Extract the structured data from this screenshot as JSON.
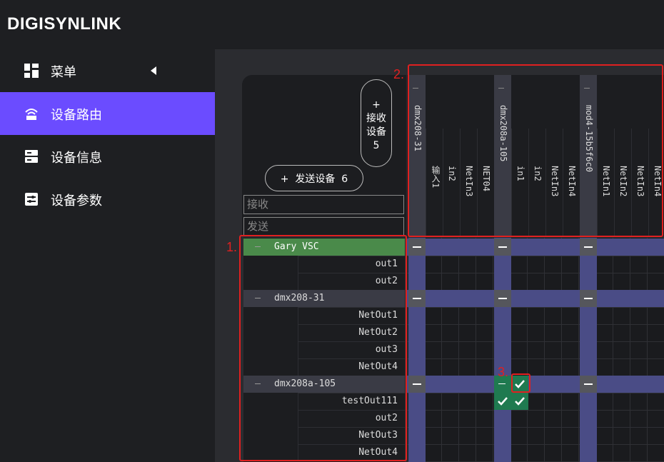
{
  "app": {
    "logo": "DIGISYNLINK"
  },
  "sidebar": {
    "items": [
      {
        "label": "菜单",
        "icon": "dashboard-icon"
      },
      {
        "label": "设备路由",
        "icon": "router-icon",
        "active": true
      },
      {
        "label": "设备信息",
        "icon": "server-icon"
      },
      {
        "label": "设备参数",
        "icon": "sliders-icon"
      }
    ],
    "collapse_icon": "caret-left-icon"
  },
  "controls": {
    "receive_button": {
      "plus": "+",
      "line1": "接收",
      "line2": "设备",
      "count": "5"
    },
    "send_button": {
      "label": "+  发送设备  6"
    },
    "filter_receive": {
      "placeholder": "接收"
    },
    "filter_send": {
      "placeholder": "发送"
    }
  },
  "receive_devices": [
    {
      "name": "dmx208-31",
      "channels": [
        "输入1",
        "in2",
        "NetIn3",
        "NET04"
      ]
    },
    {
      "name": "dmx208a-105",
      "channels": [
        "in1",
        "in2",
        "NetIn3",
        "NetIn4"
      ]
    },
    {
      "name": "mod4-15b5f6c0",
      "channels": [
        "NetIn1",
        "NetIn2",
        "NetIn3",
        "NetIn4"
      ]
    }
  ],
  "send_devices": [
    {
      "name": "Gary VSC",
      "channels": [
        "out1",
        "out2"
      ]
    },
    {
      "name": "dmx208-31",
      "channels": [
        "NetOut1",
        "NetOut2",
        "out3",
        "NetOut4"
      ]
    },
    {
      "name": "dmx208a-105",
      "channels": [
        "testOut111",
        "out2",
        "NetOut3",
        "NetOut4"
      ]
    }
  ],
  "annotations": [
    "1.",
    "2.",
    "3."
  ],
  "colors": {
    "accent": "#6b4cff",
    "device_band": "#4a4c86",
    "connected": "#1f7a50",
    "highlight_device": "#4a8a4a",
    "annotation": "#e02020"
  }
}
